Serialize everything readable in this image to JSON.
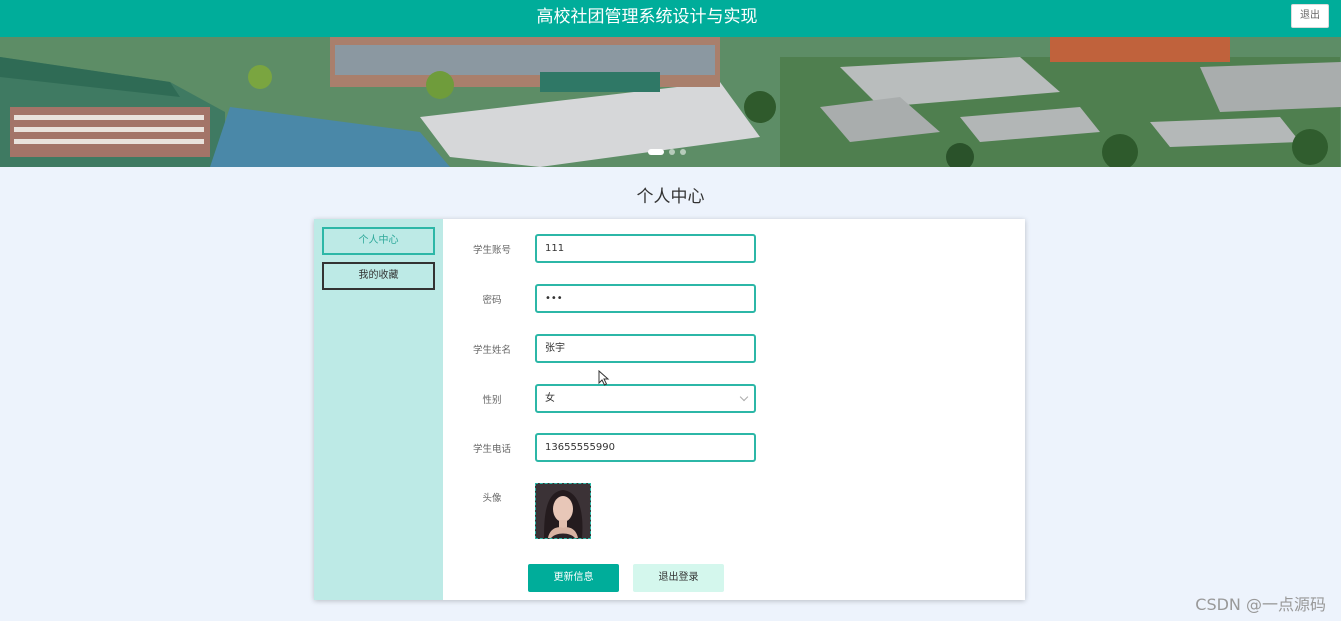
{
  "header": {
    "title": "高校社团管理系统设计与实现",
    "logout_label": "退出"
  },
  "banner": {
    "image": "campus-aerial-banner",
    "slides": 3,
    "active_slide": 1
  },
  "page_title": "个人中心",
  "sidebar": {
    "items": [
      {
        "label": "个人中心",
        "active": true
      },
      {
        "label": "我的收藏",
        "active": false
      }
    ]
  },
  "form": {
    "account": {
      "label": "学生账号",
      "value": "111"
    },
    "password": {
      "label": "密码",
      "value": "•••"
    },
    "name": {
      "label": "学生姓名",
      "value": "张宇"
    },
    "gender": {
      "label": "性别",
      "value": "女"
    },
    "phone": {
      "label": "学生电话",
      "value": "13655555990"
    },
    "avatar": {
      "label": "头像",
      "image": "avatar-photo"
    }
  },
  "buttons": {
    "update": "更新信息",
    "logout": "退出登录"
  },
  "watermark": "CSDN @一点源码",
  "colors": {
    "primary": "#00ad9a",
    "sidebar_bg": "#bdeae6",
    "page_bg": "#edf3fc",
    "field_border": "#2cb7a7",
    "secondary_button": "#d4f7ed"
  }
}
